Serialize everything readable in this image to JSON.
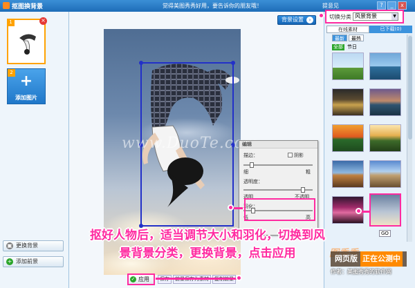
{
  "window": {
    "title": "抠图换背景",
    "slogan": "觉得美图秀秀好用，要告诉你的朋友哦！",
    "feedback": "提意见",
    "controls": [
      "?",
      "_",
      "x"
    ]
  },
  "left_panel": {
    "thumb_number": "1",
    "add_number": "2",
    "add_label": "添加图片",
    "change_bg": "更换背景",
    "add_fg": "添加前景"
  },
  "canvas": {
    "bg_settings": "背景设置",
    "watermark": "www.DuoTe.com"
  },
  "edit_panel": {
    "title": "编辑",
    "stroke_label": "描边：",
    "shadow_label": "阴影",
    "thin": "细",
    "thick": "粗",
    "opacity_label": "透明度：",
    "transparent": "透明",
    "opaque": "不透明",
    "feather_label": "羽化：",
    "low": "低",
    "high": "高",
    "feather_level": 0.12,
    "opacity_level": 0.88,
    "stroke_level": 0.1
  },
  "right_panel": {
    "switch_label": "切换分类",
    "category": "风景背景",
    "tabs": [
      "在线素材",
      "已下载(0)"
    ],
    "sub_tabs": [
      "最新",
      "最热"
    ],
    "filter_tabs": [
      "全部",
      "节日"
    ],
    "page_go": "GO"
  },
  "bottom": {
    "apply": "应用",
    "extra": [
      "保存",
      "前景保存为素材",
      "复制前景"
    ]
  },
  "instruction": {
    "line1": "抠好人物后，适当调节大小和羽化，切换到风",
    "line2": "景背景分类，更换背景，点击应用"
  },
  "site_watermark": {
    "line1": "图秀秀",
    "line2a": "网页版",
    "line2b": "正在公测中",
    "line3": "作者：美图秀秀的软件网"
  }
}
